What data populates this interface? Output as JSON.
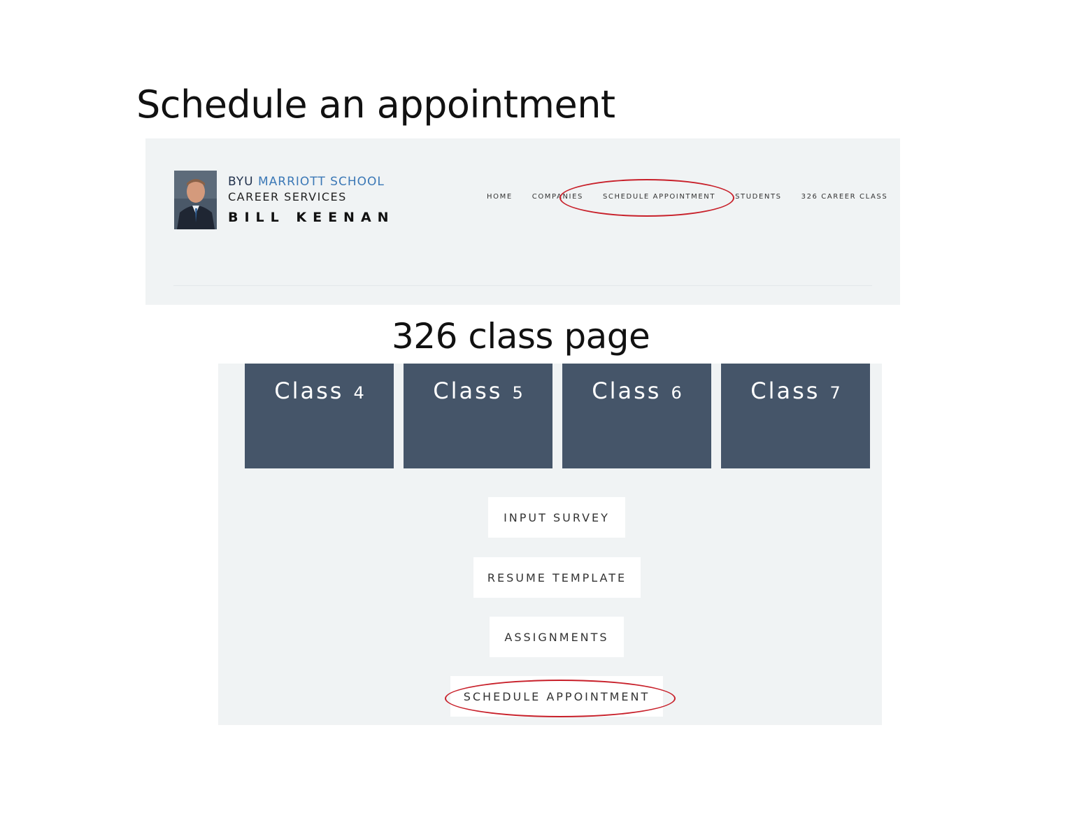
{
  "slide": {
    "title": "Schedule an appointment",
    "subtitle": "326 class page"
  },
  "header": {
    "brand_byu": "BYU",
    "brand_school": "MARRIOTT SCHOOL",
    "brand_services": "CAREER SERVICES",
    "brand_name": "BILL KEENAN",
    "nav": [
      "HOME",
      "COMPANIES",
      "SCHEDULE APPOINTMENT",
      "STUDENTS",
      "326 CAREER CLASS"
    ]
  },
  "class_page": {
    "tiles": [
      {
        "label": "Class",
        "number": "4"
      },
      {
        "label": "Class",
        "number": "5"
      },
      {
        "label": "Class",
        "number": "6"
      },
      {
        "label": "Class",
        "number": "7"
      }
    ],
    "buttons": [
      "INPUT SURVEY",
      "RESUME TEMPLATE",
      "ASSIGNMENTS",
      "SCHEDULE APPOINTMENT"
    ]
  },
  "colors": {
    "tile_bg": "#455569",
    "panel_bg": "#f0f3f4",
    "brand_accent": "#3b78b6",
    "annotation": "#c8202a"
  }
}
